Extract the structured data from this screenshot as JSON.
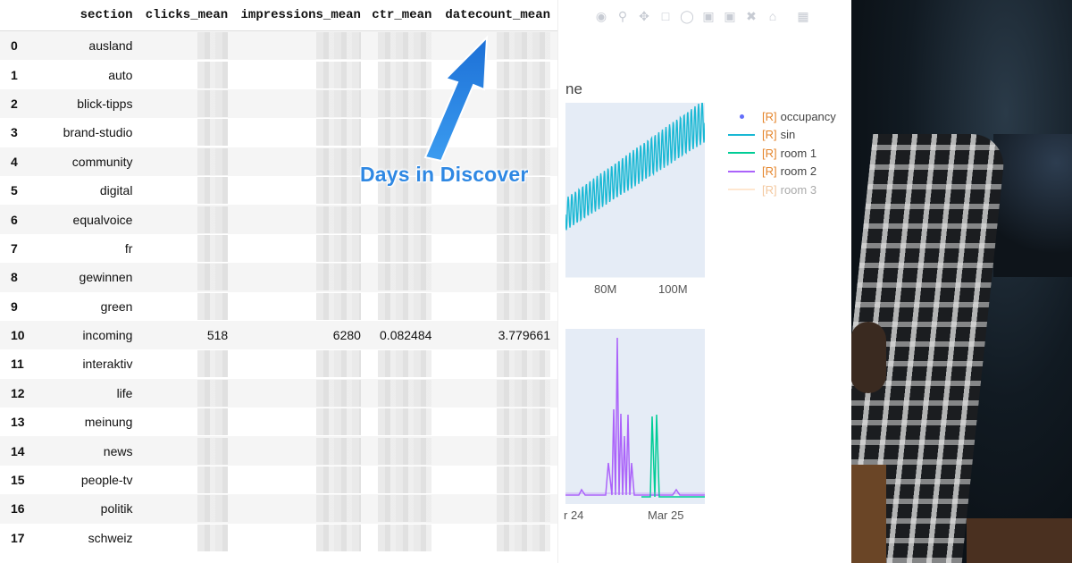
{
  "table": {
    "columns": [
      "section",
      "clicks_mean",
      "impressions_mean",
      "ctr_mean",
      "datecount_mean"
    ],
    "rows": [
      {
        "idx": "0",
        "section": "ausland"
      },
      {
        "idx": "1",
        "section": "auto"
      },
      {
        "idx": "2",
        "section": "blick-tipps"
      },
      {
        "idx": "3",
        "section": "brand-studio"
      },
      {
        "idx": "4",
        "section": "community"
      },
      {
        "idx": "5",
        "section": "digital"
      },
      {
        "idx": "6",
        "section": "equalvoice"
      },
      {
        "idx": "7",
        "section": "fr"
      },
      {
        "idx": "8",
        "section": "gewinnen"
      },
      {
        "idx": "9",
        "section": "green"
      },
      {
        "idx": "10",
        "section": "incoming",
        "clicks": "518",
        "impressions": "6280",
        "ctr": "0.082484",
        "datecount": "3.779661"
      },
      {
        "idx": "11",
        "section": "interaktiv"
      },
      {
        "idx": "12",
        "section": "life"
      },
      {
        "idx": "13",
        "section": "meinung"
      },
      {
        "idx": "14",
        "section": "news"
      },
      {
        "idx": "15",
        "section": "people-tv"
      },
      {
        "idx": "16",
        "section": "politik"
      },
      {
        "idx": "17",
        "section": "schweiz"
      }
    ]
  },
  "annotation": {
    "label": "Days in Discover",
    "color": "#2f88e3"
  },
  "plot": {
    "title_fragment": "ne",
    "top_ticks": [
      "80M",
      "100M"
    ],
    "bottom_ticks": [
      "r 24",
      "Mar 25"
    ],
    "legend": [
      {
        "tag": "[R]",
        "label": "occupancy",
        "kind": "dot",
        "color": "#636efa"
      },
      {
        "tag": "[R]",
        "label": "sin",
        "kind": "line",
        "color": "#19b8d4"
      },
      {
        "tag": "[R]",
        "label": "room 1",
        "kind": "line",
        "color": "#00cc96"
      },
      {
        "tag": "[R]",
        "label": "room 2",
        "kind": "line",
        "color": "#ab63fa"
      },
      {
        "tag": "[R]",
        "label": "room 3",
        "kind": "line",
        "color": "#ffcc99",
        "faded": true
      }
    ],
    "modebar_icons": [
      "camera-icon",
      "zoom-icon",
      "pan-icon",
      "box-select-icon",
      "lasso-icon",
      "zoom-in-icon",
      "zoom-out-icon",
      "autoscale-icon",
      "reset-icon",
      "plotly-logo-icon"
    ]
  }
}
